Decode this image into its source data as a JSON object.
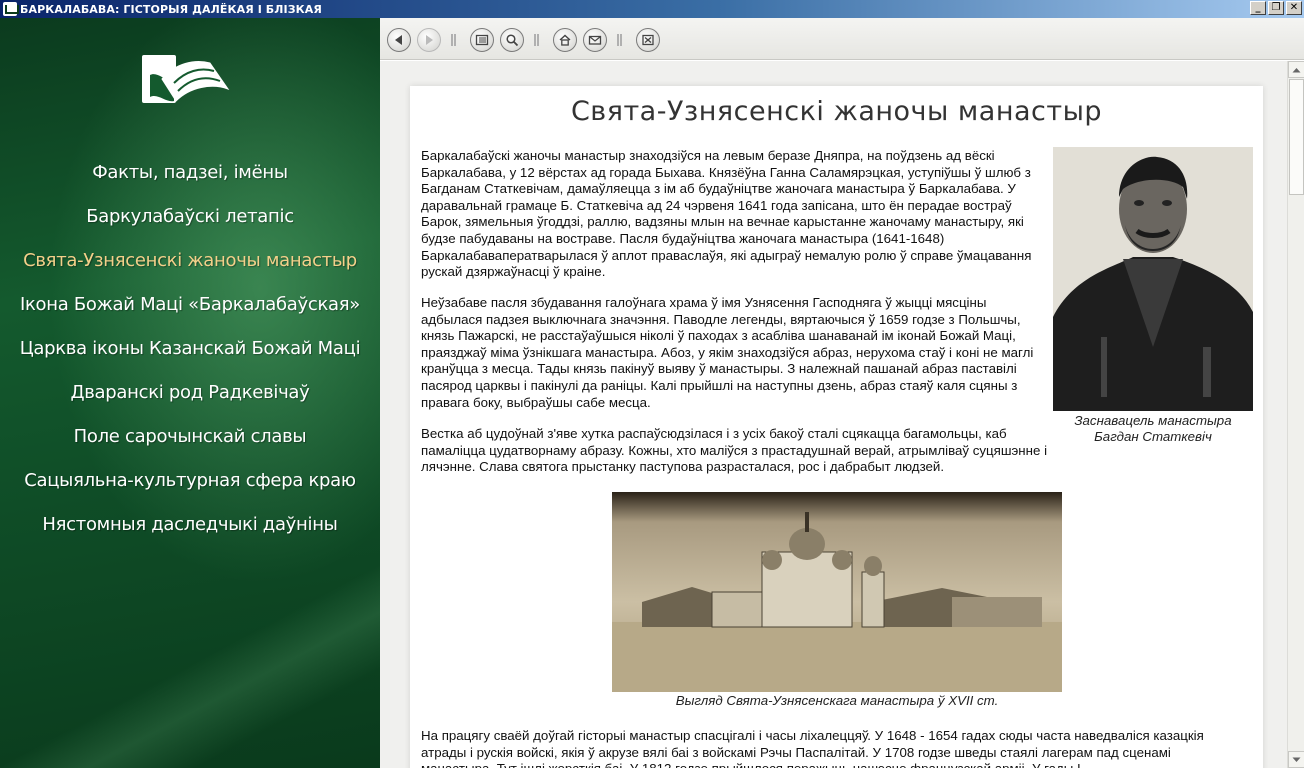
{
  "window": {
    "title": "БАРКАЛАБАВА: ГІСТОРЫЯ ДАЛЁКАЯ І БЛІЗКАЯ",
    "controls": [
      "_",
      "❐",
      "✕"
    ]
  },
  "sidebar": {
    "logo_icon": "open-book-icon",
    "items": [
      {
        "label": "Факты, падзеі, імёны",
        "active": false
      },
      {
        "label": "Баркулабаўскі летапіс",
        "active": false
      },
      {
        "label": "Свята-Узнясенскі жаночы манастыр",
        "active": true
      },
      {
        "label": "Ікона Божай Маці «Баркалабаўская»",
        "active": false
      },
      {
        "label": "Царква іконы Казанскай Божай Маці",
        "active": false
      },
      {
        "label": "Дваранскі род Радкевічаў",
        "active": false
      },
      {
        "label": "Поле сарочынскай славы",
        "active": false
      },
      {
        "label": "Сацыяльна-культурная сфера краю",
        "active": false
      },
      {
        "label": "Нястомныя даследчыкі даўніны",
        "active": false
      }
    ],
    "colors": {
      "text": "#ffffff",
      "active": "#f3d08a",
      "background": "#145a2e"
    }
  },
  "toolbar": {
    "buttons": [
      {
        "icon": "back-arrow-icon",
        "enabled": true
      },
      {
        "icon": "forward-arrow-icon",
        "enabled": false
      },
      {
        "icon": "contents-icon",
        "enabled": true
      },
      {
        "icon": "search-icon",
        "enabled": true
      },
      {
        "icon": "home-icon",
        "enabled": true
      },
      {
        "icon": "mail-icon",
        "enabled": true
      },
      {
        "icon": "exit-icon",
        "enabled": true
      }
    ]
  },
  "article": {
    "title": "Свята-Узнясенскі жаночы манастыр",
    "paragraphs": [
      "Баркалабаўскі жаночы манастыр знаходзіўся на левым беразе Дняпра, на поўдзень ад вёскі Баркалабава, у 12 вёрстах ад горада Быхава. Князёўна Ганна Саламярэцкая, уступіўшы ў шлюб з Багданам Статкевічам, дамаўляецца з ім аб будаўніцтве жаночага манастыра ў Баркалабава. У даравальнай грамаце Б. Статкевіча ад 24 чэрвеня 1641 года запісана, што ён перадае востраў Барок, зямельныя ўгоддзі, раллю, вадзяны млын на вечнае карыстанне жаночаму манастыру, які будзе пабудаваны на востраве. Пасля будаўніцтва жаночага манастыра (1641-1648) Баркалабаваператварылася ў аплот праваслаўя, які адыграў немалую ролю ў справе ўмацавання рускай дзяржаўнасці ў краіне.",
      "Неўзабаве пасля збудавання галоўнага храма ў імя Узнясення Гасподняга ў жыцці мясціны адбылася падзея выключнага значэння. Паводле легенды, вяртаючыся ў 1659 годзе з Польшчы, князь Пажарскі, не расстаўаўшыся ніколі ў паходах з асабліва шанаванай ім іконай Божай Маці, праязджаў міма ўзнікшага манастыра. Абоз, у якім знаходзіўся абраз, нерухома стаў і коні не маглі кранўцца з месца. Тады князь пакінуў выяву ў манастыры. З належнай пашанай абраз паставілі пасярод царквы і пакінулі да раніцы. Калі прыйшлі на наступны дзень, абраз стаяў каля сцяны з правага боку, выбраўшы сабе месца.",
      "Вестка аб цудоўнай з'яве хутка распаўсюдзілася і з усіх бакоў сталі сцякацца багамольцы, каб памаліцца цудатворнаму абразу. Кожны, хто маліўся з прастадушнай верай, атрымліваў суцяшэнне і лячэнне. Слава святога прыстанку паступова разрасталася, рос і дабрабыт людзей.",
      "На працягу сваёй доўгай гісторыі манастыр спасцігалі і часы ліхалеццяў. У 1648 - 1654 гадах сюды часта наведваліся казацкія атрады і рускія войскі, якія ў акрузе вялі баі з войскамі Рэчы Паспалітай. У 1708 годзе шведы стаялі лагерам пад сценамі манастыра. Тут ішлі жорсткія баі. У 1812 годзе прыйшлося перажыць нашэсце французскай арміі. У гады І"
    ],
    "portrait_caption_line1": "Заснавацель манастыра",
    "portrait_caption_line2": "Багдан Статкевіч",
    "image_caption": "Выгляд Свята-Узнясенскага манастыра ў XVII ст."
  }
}
